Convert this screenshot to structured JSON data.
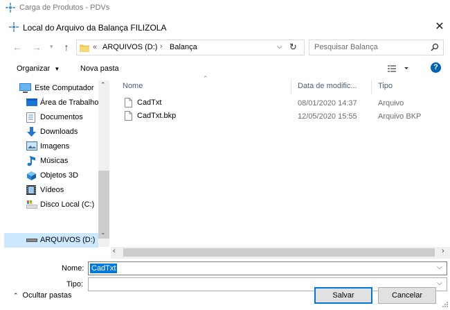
{
  "app": {
    "title": "Carga de Produtos - PDVs"
  },
  "dialog": {
    "title": "Local do Arquivo da Balança FILIZOLA",
    "close_glyph": "✕"
  },
  "navigation": {
    "back_glyph": "←",
    "forward_glyph": "→",
    "up_glyph": "↑",
    "path_prefix": "«",
    "path": [
      "ARQUIVOS (D:)",
      "Balança"
    ],
    "path_sep": "›",
    "search_placeholder": "Pesquisar Balança"
  },
  "toolbar": {
    "organize_label": "Organizar",
    "new_folder_label": "Nova pasta",
    "help_glyph": "?"
  },
  "sidebar": {
    "items": [
      {
        "label": "Este Computador",
        "icon": "computer-icon"
      },
      {
        "label": "Área de Trabalho",
        "icon": "desktop-icon"
      },
      {
        "label": "Documentos",
        "icon": "documents-icon"
      },
      {
        "label": "Downloads",
        "icon": "downloads-icon"
      },
      {
        "label": "Imagens",
        "icon": "pictures-icon"
      },
      {
        "label": "Músicas",
        "icon": "music-icon"
      },
      {
        "label": "Objetos 3D",
        "icon": "objects3d-icon"
      },
      {
        "label": "Vídeos",
        "icon": "videos-icon"
      },
      {
        "label": "Disco Local (C:)",
        "icon": "local-disk-icon"
      },
      {
        "label": "ARQUIVOS (D:)",
        "icon": "drive-icon",
        "selected": true
      }
    ]
  },
  "file_list": {
    "columns": {
      "name": "Nome",
      "date": "Data de modific...",
      "type": "Tipo"
    },
    "rows": [
      {
        "name": "CadTxt",
        "date": "08/01/2020 14:37",
        "type": "Arquivo"
      },
      {
        "name": "CadTxt.bkp",
        "date": "12/05/2020 15:55",
        "type": "Arquivo BKP"
      }
    ]
  },
  "form": {
    "name_label": "Nome:",
    "name_value": "CadTxt",
    "type_label": "Tipo:",
    "type_value": ""
  },
  "footer": {
    "hide_folders_label": "Ocultar pastas",
    "save_label": "Salvar",
    "cancel_label": "Cancelar"
  },
  "colors": {
    "accent": "#0078d7",
    "selection": "#cce8ff",
    "help": "#0063b1"
  }
}
